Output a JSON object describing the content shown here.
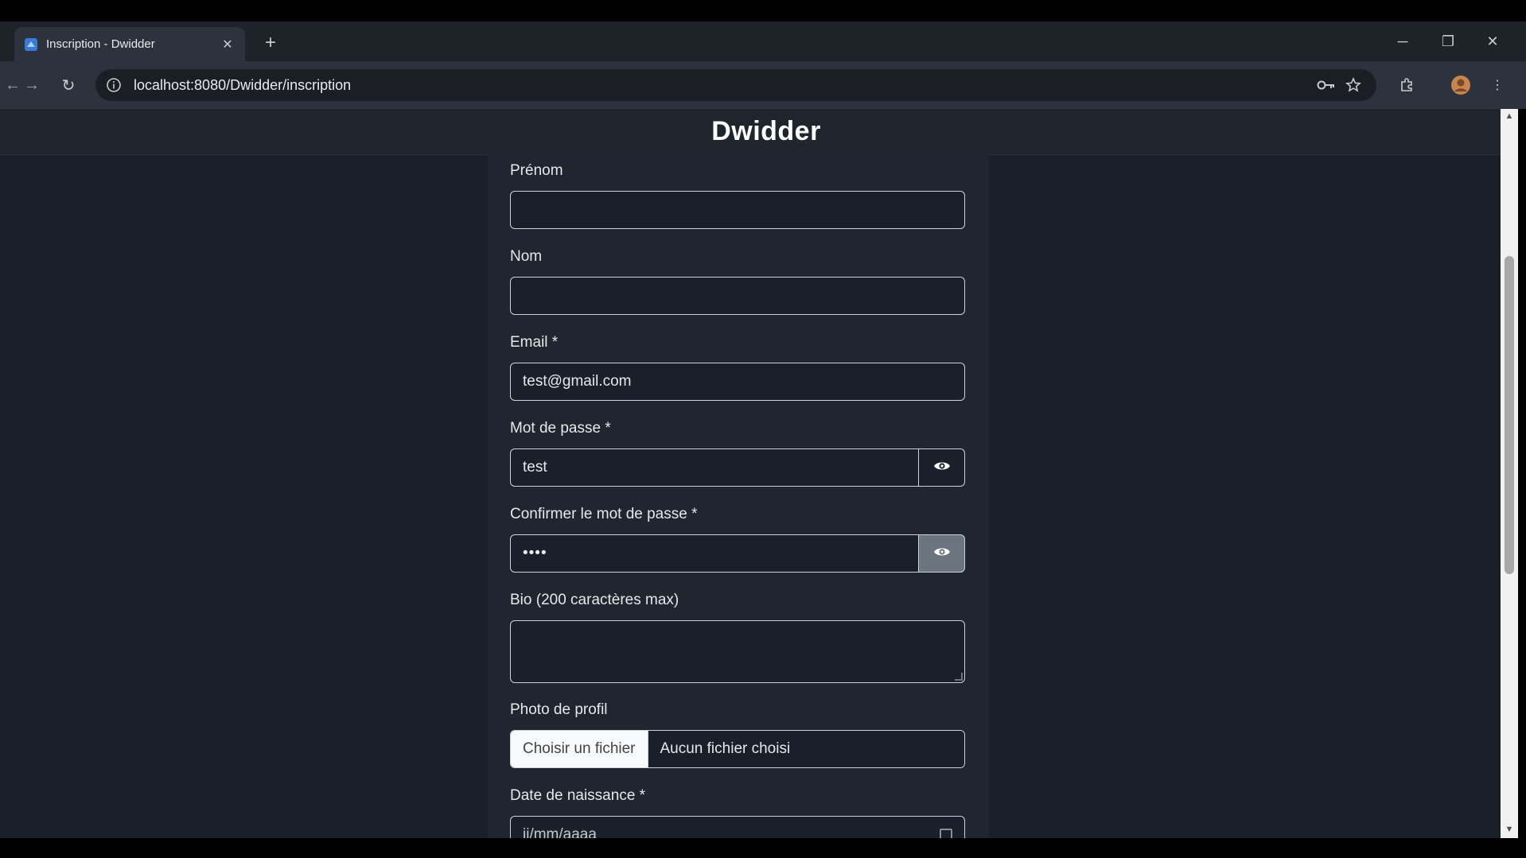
{
  "browser": {
    "tab_title": "Inscription - Dwidder",
    "url": "localhost:8080/Dwidder/inscription"
  },
  "app": {
    "brand": "Dwidder"
  },
  "form": {
    "prenom_label": "Prénom",
    "prenom_value": "",
    "nom_label": "Nom",
    "nom_value": "",
    "email_label": "Email *",
    "email_value": "test@gmail.com",
    "password_label": "Mot de passe *",
    "password_value": "test",
    "confirm_label": "Confirmer le mot de passe *",
    "confirm_value": "••••",
    "bio_label": "Bio (200 caractères max)",
    "photo_label": "Photo de profil",
    "file_button": "Choisir un fichier",
    "file_status": "Aucun fichier choisi",
    "birth_label": "Date de naissance *",
    "birth_placeholder": "jj/mm/aaaa"
  },
  "icons": {
    "favicon": "app-favicon-icon",
    "password_toggle": "eye-icon",
    "key": "key-icon",
    "star": "star-icon",
    "extensions": "puzzle-icon",
    "profile": "avatar",
    "menu": "kebab-menu-icon"
  }
}
